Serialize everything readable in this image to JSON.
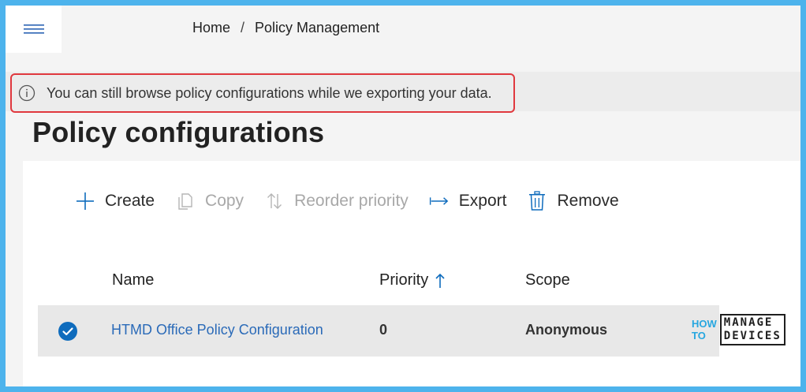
{
  "breadcrumb": {
    "home": "Home",
    "separator": "/",
    "current": "Policy Management"
  },
  "banner": {
    "message": "You can still browse policy configurations while we exporting your data.",
    "icon": "info-icon",
    "border_color": "#e0383e"
  },
  "page": {
    "title": "Policy configurations"
  },
  "toolbar": {
    "create": "Create",
    "copy": "Copy",
    "reorder": "Reorder priority",
    "export": "Export",
    "remove": "Remove"
  },
  "table": {
    "columns": {
      "name": "Name",
      "priority": "Priority",
      "scope": "Scope"
    },
    "sort": {
      "column": "priority",
      "direction": "ascending"
    },
    "rows": [
      {
        "name": "HTMD Office Policy Configuration",
        "priority": "0",
        "scope": "Anonymous",
        "selected": true
      }
    ]
  },
  "watermark": {
    "how": "HOW",
    "to": "TO",
    "manage": "MANAGE",
    "devices": "DEVICES"
  },
  "colors": {
    "accent": "#0f6cbd",
    "link": "#2a6ab8",
    "frame": "#4db3ec"
  }
}
